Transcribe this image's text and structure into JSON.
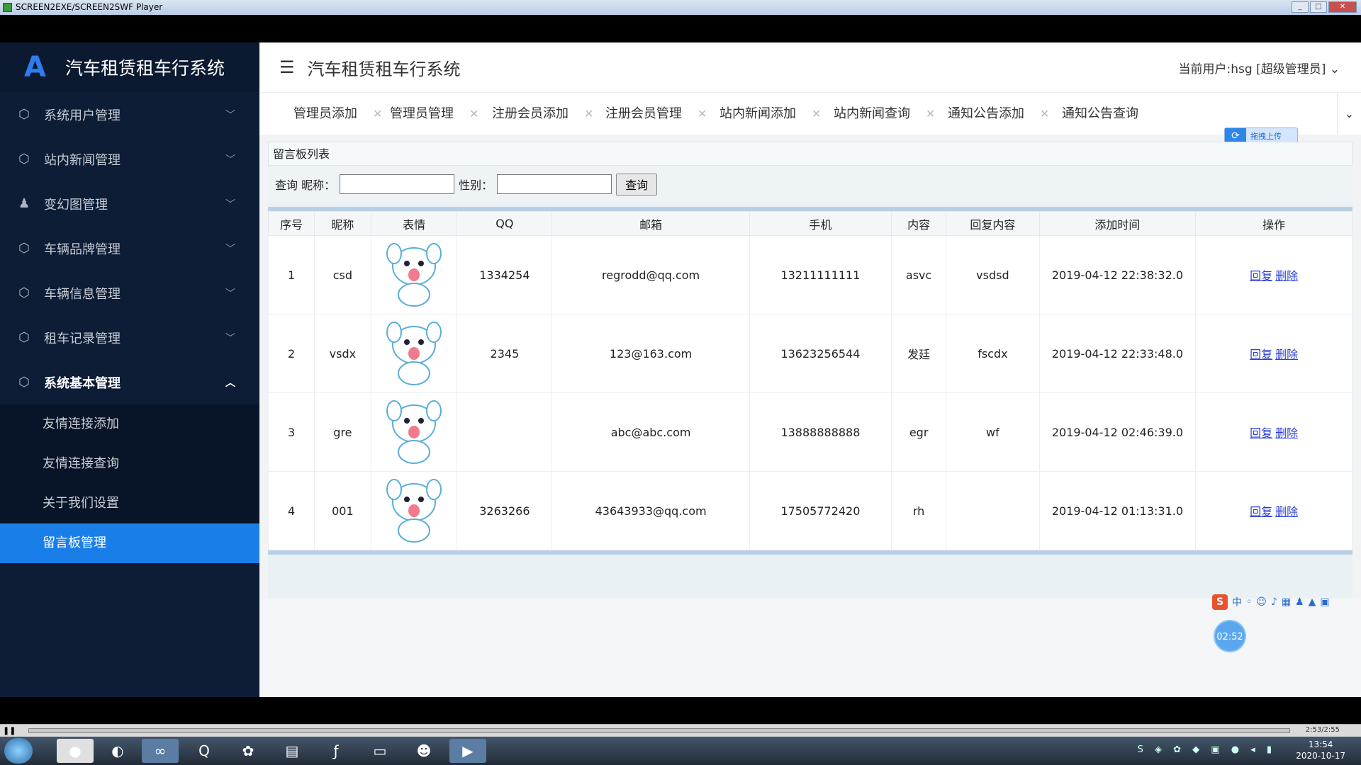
{
  "player": {
    "title": "SCREEN2EXE/SCREEN2SWF Player",
    "progress_fraction": 1.0,
    "time": "2:53/2:55"
  },
  "app": {
    "logo_letter": "A",
    "system_title": "汽车租赁租车行系统",
    "header_title": "汽车租赁租车行系统",
    "current_user": "当前用户:hsg [超级管理员]"
  },
  "sidebar": {
    "items": [
      {
        "label": "系统用户管理",
        "icon": "cube-icon"
      },
      {
        "label": "站内新闻管理",
        "icon": "cube-icon"
      },
      {
        "label": "变幻图管理",
        "icon": "user-icon"
      },
      {
        "label": "车辆品牌管理",
        "icon": "cube-icon"
      },
      {
        "label": "车辆信息管理",
        "icon": "cube-icon"
      },
      {
        "label": "租车记录管理",
        "icon": "cube-icon"
      },
      {
        "label": "系统基本管理",
        "icon": "cube-icon"
      }
    ],
    "subitems": [
      "友情连接添加",
      "友情连接查询",
      "关于我们设置",
      "留言板管理"
    ]
  },
  "tabs": [
    "管理员添加",
    "管理员管理",
    "注册会员添加",
    "注册会员管理",
    "站内新闻添加",
    "站内新闻查询",
    "通知公告添加",
    "通知公告查询"
  ],
  "upload_badge": "拖拽上传",
  "panel": {
    "title": "留言板列表",
    "query_label": "查询 昵称：",
    "gender_label": "性别：",
    "nickname_value": "",
    "gender_value": "",
    "query_button": "查询",
    "columns": [
      "序号",
      "昵称",
      "表情",
      "QQ",
      "邮箱",
      "手机",
      "内容",
      "回复内容",
      "添加时间",
      "操作"
    ],
    "rows": [
      {
        "no": "1",
        "nick": "csd",
        "qq": "1334254",
        "email": "regrodd@qq.com",
        "phone": "13211111111",
        "content": "asvc",
        "reply": "vsdsd",
        "time": "2019-04-12 22:38:32.0"
      },
      {
        "no": "2",
        "nick": "vsdx",
        "qq": "2345",
        "email": "123@163.com",
        "phone": "13623256544",
        "content": "发廷",
        "reply": "fscdx",
        "time": "2019-04-12 22:33:48.0"
      },
      {
        "no": "3",
        "nick": "gre",
        "qq": "",
        "email": "abc@abc.com",
        "phone": "13888888888",
        "content": "egr",
        "reply": "wf",
        "time": "2019-04-12 02:46:39.0"
      },
      {
        "no": "4",
        "nick": "001",
        "qq": "3263266",
        "email": "43643933@qq.com",
        "phone": "17505772420",
        "content": "rh",
        "reply": "",
        "time": "2019-04-12 01:13:31.0"
      }
    ],
    "reply_link": "回复",
    "delete_link": "删除"
  },
  "overlay": {
    "ime_char": "中",
    "timer": "02:52"
  },
  "taskbar": {
    "time": "13:54",
    "date": "2020-10-17"
  }
}
